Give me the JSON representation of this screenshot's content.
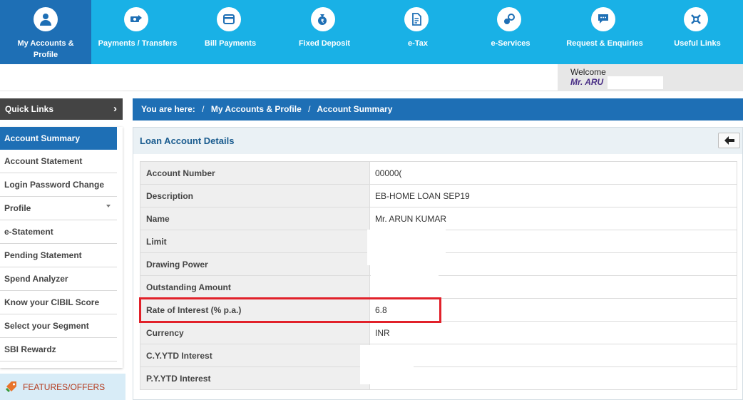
{
  "nav": {
    "items": [
      {
        "label": "My Accounts & Profile",
        "icon": "user-icon"
      },
      {
        "label": "Payments / Transfers",
        "icon": "money-transfer-icon"
      },
      {
        "label": "Bill Payments",
        "icon": "bill-card-icon"
      },
      {
        "label": "Fixed Deposit",
        "icon": "money-bag-icon"
      },
      {
        "label": "e-Tax",
        "icon": "tax-document-icon"
      },
      {
        "label": "e-Services",
        "icon": "services-icon"
      },
      {
        "label": "Request & Enquiries",
        "icon": "chat-phone-icon"
      },
      {
        "label": "Useful Links",
        "icon": "links-icon"
      }
    ]
  },
  "welcome": {
    "label": "Welcome",
    "name": "Mr. ARU"
  },
  "quick_links": {
    "title": "Quick Links",
    "items": [
      "Account Summary",
      "Account Statement",
      "Login Password Change",
      "Profile",
      "e-Statement",
      "Pending Statement",
      "Spend Analyzer",
      "Know your CIBIL Score",
      "Select your Segment",
      "SBI Rewardz"
    ]
  },
  "features": {
    "label": "FEATURES/OFFERS"
  },
  "breadcrumb": {
    "prefix": "You are here:",
    "items": [
      "My Accounts & Profile",
      "Account Summary"
    ]
  },
  "panel": {
    "title": "Loan Account Details",
    "rows": [
      {
        "label": "Account Number",
        "value": "00000("
      },
      {
        "label": "Description",
        "value": "EB-HOME LOAN SEP19"
      },
      {
        "label": "Name",
        "value": "Mr. ARUN KUMAR"
      },
      {
        "label": "Limit",
        "value": ""
      },
      {
        "label": "Drawing Power",
        "value": ""
      },
      {
        "label": "Outstanding Amount",
        "value": ""
      },
      {
        "label": "Rate of Interest (% p.a.)",
        "value": "6.8"
      },
      {
        "label": "Currency",
        "value": "INR"
      },
      {
        "label": "C.Y.YTD Interest",
        "value": ""
      },
      {
        "label": "P.Y.YTD Interest",
        "value": ""
      }
    ]
  },
  "colors": {
    "nav_bg": "#19b1e6",
    "nav_active": "#1e6fb5",
    "breadcrumb_bg": "#1e6fb5",
    "highlight_border": "#e1212a"
  }
}
